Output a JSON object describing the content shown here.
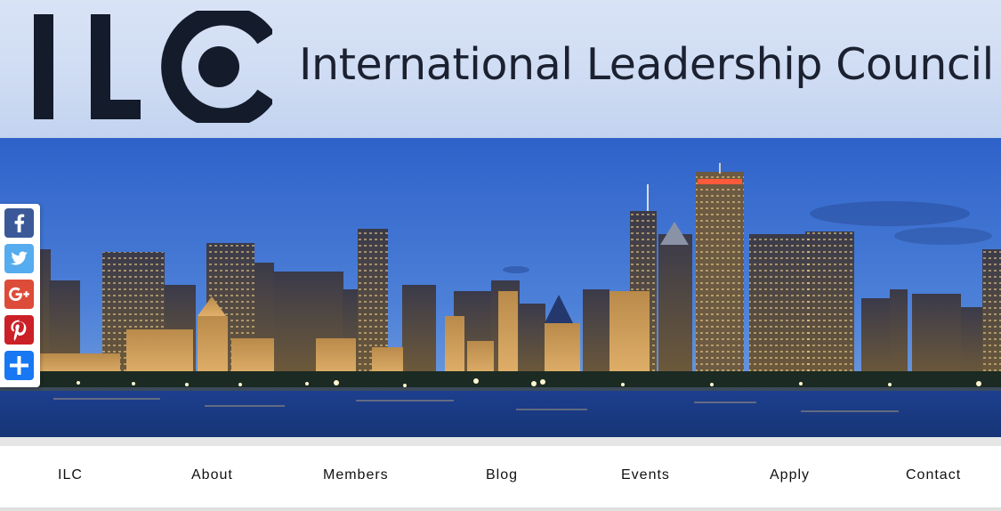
{
  "header": {
    "logo_alt": "ILC",
    "site_name": "International Leadership Council"
  },
  "hero": {
    "image_description": "Chicago skyline at dusk over the lake"
  },
  "share_bar": {
    "items": [
      {
        "icon": "facebook-icon",
        "color": "#3b5998"
      },
      {
        "icon": "twitter-icon",
        "color": "#55acee"
      },
      {
        "icon": "google-plus-icon",
        "color": "#dd4b39"
      },
      {
        "icon": "pinterest-icon",
        "color": "#cb2027"
      },
      {
        "icon": "share-plus-icon",
        "color": "#1877f2"
      }
    ]
  },
  "nav": {
    "items": [
      {
        "label": "ILC"
      },
      {
        "label": "About"
      },
      {
        "label": "Members"
      },
      {
        "label": "Blog"
      },
      {
        "label": "Events"
      },
      {
        "label": "Apply"
      },
      {
        "label": "Contact"
      }
    ]
  },
  "colors": {
    "header_bg": "#d1ddf3",
    "logo_dark": "#141b2b",
    "text_dark": "#1b2130",
    "nav_text": "#111111"
  }
}
